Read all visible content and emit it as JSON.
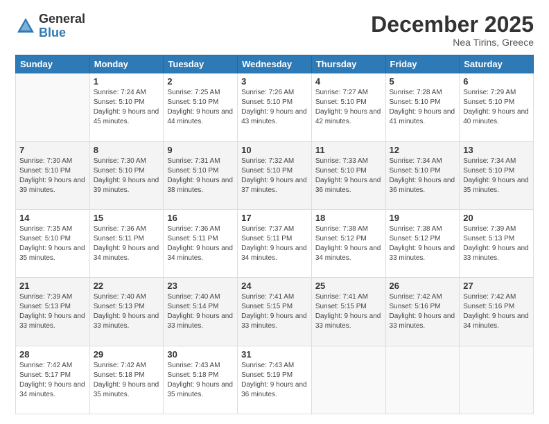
{
  "logo": {
    "general": "General",
    "blue": "Blue"
  },
  "header": {
    "month": "December 2025",
    "location": "Nea Tirins, Greece"
  },
  "weekdays": [
    "Sunday",
    "Monday",
    "Tuesday",
    "Wednesday",
    "Thursday",
    "Friday",
    "Saturday"
  ],
  "weeks": [
    [
      {
        "day": "",
        "sunrise": "",
        "sunset": "",
        "daylight": ""
      },
      {
        "day": "1",
        "sunrise": "Sunrise: 7:24 AM",
        "sunset": "Sunset: 5:10 PM",
        "daylight": "Daylight: 9 hours and 45 minutes."
      },
      {
        "day": "2",
        "sunrise": "Sunrise: 7:25 AM",
        "sunset": "Sunset: 5:10 PM",
        "daylight": "Daylight: 9 hours and 44 minutes."
      },
      {
        "day": "3",
        "sunrise": "Sunrise: 7:26 AM",
        "sunset": "Sunset: 5:10 PM",
        "daylight": "Daylight: 9 hours and 43 minutes."
      },
      {
        "day": "4",
        "sunrise": "Sunrise: 7:27 AM",
        "sunset": "Sunset: 5:10 PM",
        "daylight": "Daylight: 9 hours and 42 minutes."
      },
      {
        "day": "5",
        "sunrise": "Sunrise: 7:28 AM",
        "sunset": "Sunset: 5:10 PM",
        "daylight": "Daylight: 9 hours and 41 minutes."
      },
      {
        "day": "6",
        "sunrise": "Sunrise: 7:29 AM",
        "sunset": "Sunset: 5:10 PM",
        "daylight": "Daylight: 9 hours and 40 minutes."
      }
    ],
    [
      {
        "day": "7",
        "sunrise": "Sunrise: 7:30 AM",
        "sunset": "Sunset: 5:10 PM",
        "daylight": "Daylight: 9 hours and 39 minutes."
      },
      {
        "day": "8",
        "sunrise": "Sunrise: 7:30 AM",
        "sunset": "Sunset: 5:10 PM",
        "daylight": "Daylight: 9 hours and 39 minutes."
      },
      {
        "day": "9",
        "sunrise": "Sunrise: 7:31 AM",
        "sunset": "Sunset: 5:10 PM",
        "daylight": "Daylight: 9 hours and 38 minutes."
      },
      {
        "day": "10",
        "sunrise": "Sunrise: 7:32 AM",
        "sunset": "Sunset: 5:10 PM",
        "daylight": "Daylight: 9 hours and 37 minutes."
      },
      {
        "day": "11",
        "sunrise": "Sunrise: 7:33 AM",
        "sunset": "Sunset: 5:10 PM",
        "daylight": "Daylight: 9 hours and 36 minutes."
      },
      {
        "day": "12",
        "sunrise": "Sunrise: 7:34 AM",
        "sunset": "Sunset: 5:10 PM",
        "daylight": "Daylight: 9 hours and 36 minutes."
      },
      {
        "day": "13",
        "sunrise": "Sunrise: 7:34 AM",
        "sunset": "Sunset: 5:10 PM",
        "daylight": "Daylight: 9 hours and 35 minutes."
      }
    ],
    [
      {
        "day": "14",
        "sunrise": "Sunrise: 7:35 AM",
        "sunset": "Sunset: 5:10 PM",
        "daylight": "Daylight: 9 hours and 35 minutes."
      },
      {
        "day": "15",
        "sunrise": "Sunrise: 7:36 AM",
        "sunset": "Sunset: 5:11 PM",
        "daylight": "Daylight: 9 hours and 34 minutes."
      },
      {
        "day": "16",
        "sunrise": "Sunrise: 7:36 AM",
        "sunset": "Sunset: 5:11 PM",
        "daylight": "Daylight: 9 hours and 34 minutes."
      },
      {
        "day": "17",
        "sunrise": "Sunrise: 7:37 AM",
        "sunset": "Sunset: 5:11 PM",
        "daylight": "Daylight: 9 hours and 34 minutes."
      },
      {
        "day": "18",
        "sunrise": "Sunrise: 7:38 AM",
        "sunset": "Sunset: 5:12 PM",
        "daylight": "Daylight: 9 hours and 34 minutes."
      },
      {
        "day": "19",
        "sunrise": "Sunrise: 7:38 AM",
        "sunset": "Sunset: 5:12 PM",
        "daylight": "Daylight: 9 hours and 33 minutes."
      },
      {
        "day": "20",
        "sunrise": "Sunrise: 7:39 AM",
        "sunset": "Sunset: 5:13 PM",
        "daylight": "Daylight: 9 hours and 33 minutes."
      }
    ],
    [
      {
        "day": "21",
        "sunrise": "Sunrise: 7:39 AM",
        "sunset": "Sunset: 5:13 PM",
        "daylight": "Daylight: 9 hours and 33 minutes."
      },
      {
        "day": "22",
        "sunrise": "Sunrise: 7:40 AM",
        "sunset": "Sunset: 5:13 PM",
        "daylight": "Daylight: 9 hours and 33 minutes."
      },
      {
        "day": "23",
        "sunrise": "Sunrise: 7:40 AM",
        "sunset": "Sunset: 5:14 PM",
        "daylight": "Daylight: 9 hours and 33 minutes."
      },
      {
        "day": "24",
        "sunrise": "Sunrise: 7:41 AM",
        "sunset": "Sunset: 5:15 PM",
        "daylight": "Daylight: 9 hours and 33 minutes."
      },
      {
        "day": "25",
        "sunrise": "Sunrise: 7:41 AM",
        "sunset": "Sunset: 5:15 PM",
        "daylight": "Daylight: 9 hours and 33 minutes."
      },
      {
        "day": "26",
        "sunrise": "Sunrise: 7:42 AM",
        "sunset": "Sunset: 5:16 PM",
        "daylight": "Daylight: 9 hours and 33 minutes."
      },
      {
        "day": "27",
        "sunrise": "Sunrise: 7:42 AM",
        "sunset": "Sunset: 5:16 PM",
        "daylight": "Daylight: 9 hours and 34 minutes."
      }
    ],
    [
      {
        "day": "28",
        "sunrise": "Sunrise: 7:42 AM",
        "sunset": "Sunset: 5:17 PM",
        "daylight": "Daylight: 9 hours and 34 minutes."
      },
      {
        "day": "29",
        "sunrise": "Sunrise: 7:42 AM",
        "sunset": "Sunset: 5:18 PM",
        "daylight": "Daylight: 9 hours and 35 minutes."
      },
      {
        "day": "30",
        "sunrise": "Sunrise: 7:43 AM",
        "sunset": "Sunset: 5:18 PM",
        "daylight": "Daylight: 9 hours and 35 minutes."
      },
      {
        "day": "31",
        "sunrise": "Sunrise: 7:43 AM",
        "sunset": "Sunset: 5:19 PM",
        "daylight": "Daylight: 9 hours and 36 minutes."
      },
      {
        "day": "",
        "sunrise": "",
        "sunset": "",
        "daylight": ""
      },
      {
        "day": "",
        "sunrise": "",
        "sunset": "",
        "daylight": ""
      },
      {
        "day": "",
        "sunrise": "",
        "sunset": "",
        "daylight": ""
      }
    ]
  ]
}
